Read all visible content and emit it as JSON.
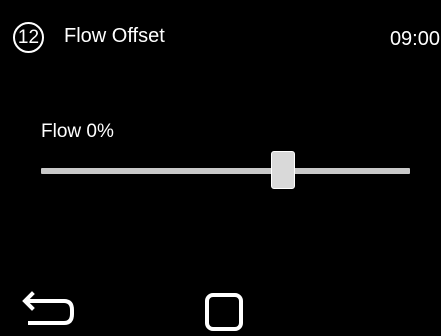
{
  "header": {
    "step_number": "12",
    "title": "Flow Offset",
    "time": "09:00"
  },
  "slider": {
    "label": "Flow 0%",
    "value_fraction": 0.655
  },
  "nav": {
    "back_icon": "back-arrow-icon",
    "home_icon": "square-home-icon"
  },
  "colors": {
    "background": "#000000",
    "text": "#ffffff",
    "track": "#c9c9c9",
    "thumb": "#d9d9d9"
  }
}
